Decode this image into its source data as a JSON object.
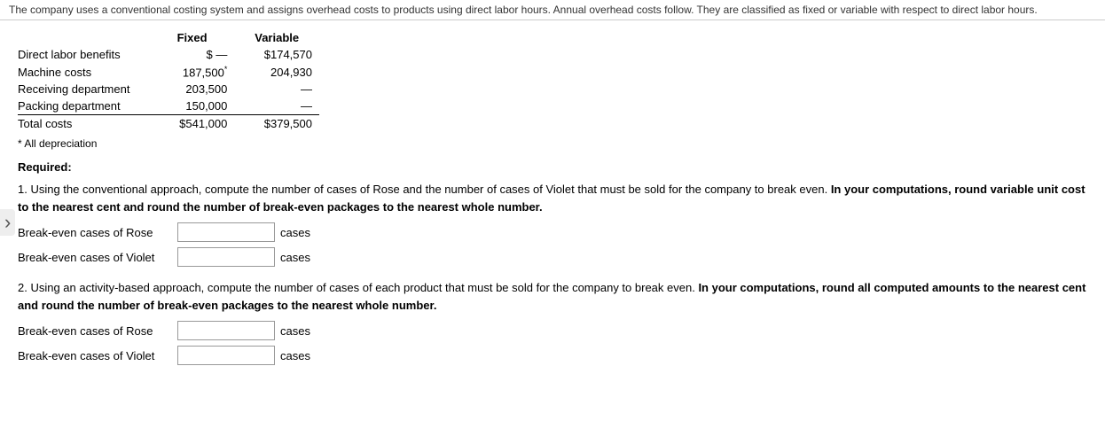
{
  "top_bar": {
    "text": "The company uses a conventional costing system and assigns overhead costs to products using direct labor hours. Annual overhead costs follow. They are classified as fixed or variable with respect to direct labor hours."
  },
  "table": {
    "headers": {
      "fixed": "Fixed",
      "variable": "Variable"
    },
    "rows": [
      {
        "label": "Direct labor benefits",
        "fixed": "$    —",
        "variable": "$174,570",
        "has_asterisk": false,
        "fixed_border_bottom": false
      },
      {
        "label": "Machine costs",
        "fixed": "187,500",
        "variable": "204,930",
        "has_asterisk": true,
        "fixed_border_bottom": false
      },
      {
        "label": "Receiving department",
        "fixed": "203,500",
        "variable": "—",
        "has_asterisk": false,
        "fixed_border_bottom": false
      },
      {
        "label": "Packing department",
        "fixed": "150,000",
        "variable": "—",
        "has_asterisk": false,
        "fixed_border_bottom": true
      }
    ],
    "total_row": {
      "label": "Total costs",
      "fixed": "$541,000",
      "variable": "$379,500"
    }
  },
  "footnote": "* All depreciation",
  "required_label": "Required:",
  "question1": {
    "text_before_bold": "1. Using the conventional approach, compute the number of cases of Rose and the number of cases of Violet that must be sold for the company to break even. ",
    "text_bold": "In your computations, round variable unit cost to the nearest cent and round the number of break-even packages to the nearest whole number.",
    "inputs": [
      {
        "label": "Break-even cases of Rose",
        "unit": "cases"
      },
      {
        "label": "Break-even cases of Violet",
        "unit": "cases"
      }
    ]
  },
  "question2": {
    "text_before_bold": "2. Using an activity-based approach, compute the number of cases of each product that must be sold for the company to break even. ",
    "text_bold": "In your computations, round all computed amounts to the nearest cent and round the number of break-even packages to the nearest whole number.",
    "inputs": [
      {
        "label": "Break-even cases of Rose",
        "unit": "cases"
      },
      {
        "label": "Break-even cases of Violet",
        "unit": "cases"
      }
    ]
  },
  "left_arrow": "›"
}
